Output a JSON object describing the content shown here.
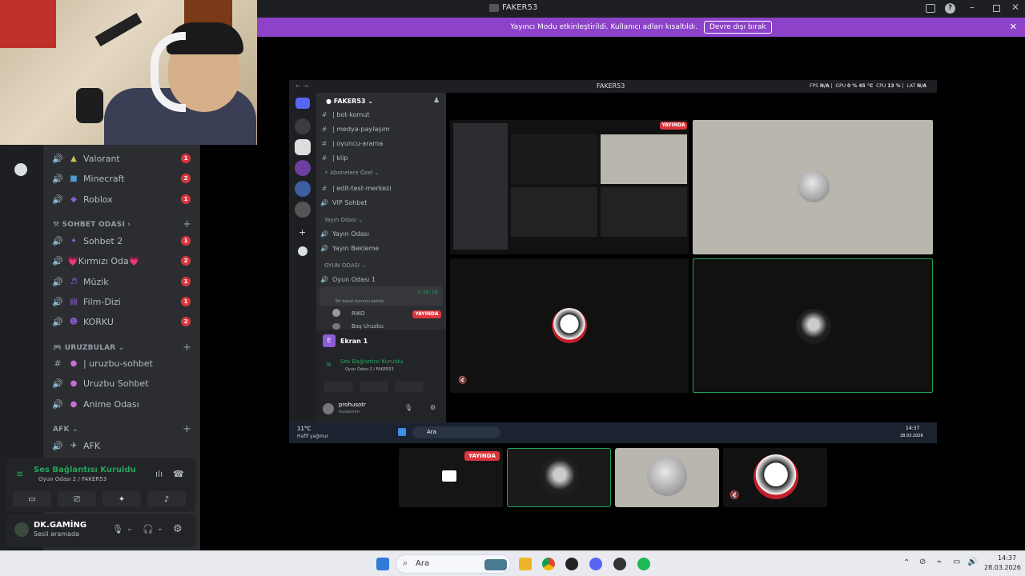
{
  "window": {
    "title": "FAKER53"
  },
  "banner": {
    "text": "Yayıncı Modu etkinleştirildi. Kullanıcı adları kısaltıldı.",
    "button": "Devre dışı bırak"
  },
  "left_channels": [
    {
      "icon": "speaker-icon",
      "emoji": "▲",
      "label": "Valorant",
      "badge": "1"
    },
    {
      "icon": "speaker-icon",
      "emoji": "■",
      "label": "Minecraft",
      "badge": "2"
    },
    {
      "icon": "speaker-icon",
      "emoji": "◆",
      "label": "Roblox",
      "badge": "1"
    }
  ],
  "categories": {
    "sohbet": "SOHBET ODASI",
    "uruzbular": "URUZBULAR",
    "afk": "AFK"
  },
  "sohbet_channels": [
    {
      "label": "Sohbet 2",
      "badge": "1"
    },
    {
      "label": "💗Kırmızı Oda💗",
      "badge": "2"
    },
    {
      "label": "Müzik",
      "badge": "1"
    },
    {
      "label": "Film-Dizi",
      "badge": "1"
    },
    {
      "label": "KORKU",
      "badge": "2"
    }
  ],
  "uruzbular_channels": [
    {
      "label": "| uruzbu-sohbet",
      "type": "text"
    },
    {
      "label": "Uruzbu Sohbet",
      "type": "voice"
    },
    {
      "label": "Anime Odası",
      "type": "voice"
    }
  ],
  "afk_channels": [
    {
      "label": "AFK"
    }
  ],
  "voice_panel": {
    "status": "Ses Bağlantısı Kuruldu",
    "location": "Oyun Odası 2 / FAKER53"
  },
  "user_panel": {
    "name": "DK.GAMİNG",
    "status": "Sesli aramada"
  },
  "shared_screen": {
    "title": "FAKER53",
    "stats": {
      "fps_label": "FPS",
      "fps": "N/A",
      "gpu_label": "GPU",
      "gpu": "0 % 45 °C",
      "cpu_label": "CPU",
      "cpu": "13 %",
      "lat_label": "LAT",
      "lat": "N/A"
    },
    "server": "FAKER53",
    "channels": [
      {
        "h": "#",
        "label": "| bot-komut"
      },
      {
        "h": "#",
        "label": "| medya-paylaşım"
      },
      {
        "h": "#",
        "label": "| oyuncu-arama"
      },
      {
        "h": "#",
        "label": "| klip"
      }
    ],
    "abonelere": "Abonelere Özel",
    "abonelere_channels": [
      {
        "h": "#",
        "label": "| edit-test-merkezi"
      },
      {
        "h": "🔊",
        "label": "VIP Sohbet"
      }
    ],
    "yayin": "Yayın Odası",
    "yayin_channels": [
      {
        "h": "🔊",
        "label": "Yayın Odası"
      },
      {
        "h": "🔊",
        "label": "Yayın Bekleme"
      }
    ],
    "oyun": "OYUN ODASI",
    "oyun_channels": [
      {
        "h": "🔊",
        "label": "Oyun Odası 1"
      },
      {
        "h": "🔊",
        "label": "Oyun Odası 2"
      }
    ],
    "oyun2_time": "3:58:19",
    "oyun2_sub": "Bir kanal durumu belirle",
    "members": [
      {
        "name": "RİKO"
      },
      {
        "name": "Baş Uruzbu"
      }
    ],
    "live": "YAYINDA",
    "screen_label": "Ekran 1",
    "voice_status": "Ses Bağlantısı Kuruldu",
    "voice_location": "Oyun Odası 2 / FAKER53",
    "user_name": "prohusotr",
    "user_status": "husayinnn",
    "weather_temp": "11°C",
    "weather_desc": "Hafif yağmur",
    "search": "Ara",
    "time": "14:37",
    "date": "28.03.2026"
  },
  "thumb_live": "YAYINDA",
  "taskbar": {
    "search": "Ara",
    "time": "14:37",
    "date": "28.03.2026"
  }
}
